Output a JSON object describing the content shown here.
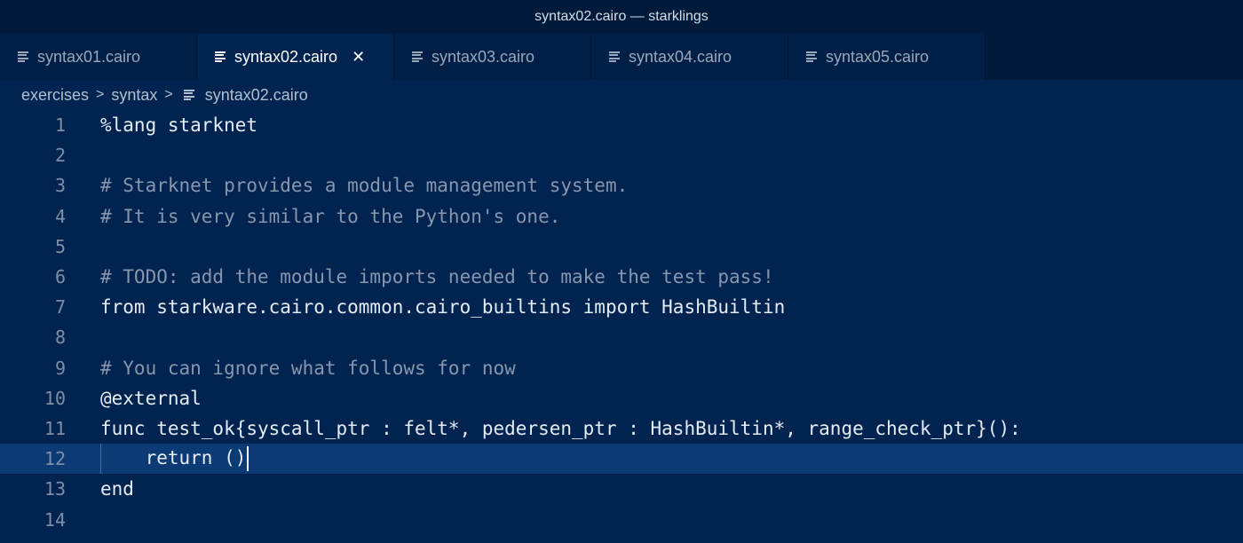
{
  "window": {
    "title": "syntax02.cairo — starklings"
  },
  "tabs": [
    {
      "label": "syntax01.cairo",
      "active": false
    },
    {
      "label": "syntax02.cairo",
      "active": true,
      "close": "✕"
    },
    {
      "label": "syntax03.cairo",
      "active": false
    },
    {
      "label": "syntax04.cairo",
      "active": false
    },
    {
      "label": "syntax05.cairo",
      "active": false
    }
  ],
  "breadcrumb": {
    "items": [
      "exercises",
      "syntax",
      "syntax02.cairo"
    ],
    "separator": ">"
  },
  "editor": {
    "current_line": 12,
    "lines": [
      {
        "num": "1",
        "text": "%lang starknet",
        "kind": "code"
      },
      {
        "num": "2",
        "text": "",
        "kind": "code"
      },
      {
        "num": "3",
        "text": "# Starknet provides a module management system.",
        "kind": "comment"
      },
      {
        "num": "4",
        "text": "# It is very similar to the Python's one.",
        "kind": "comment"
      },
      {
        "num": "5",
        "text": "",
        "kind": "code"
      },
      {
        "num": "6",
        "text": "# TODO: add the module imports needed to make the test pass!",
        "kind": "comment"
      },
      {
        "num": "7",
        "text": "from starkware.cairo.common.cairo_builtins import HashBuiltin",
        "kind": "code"
      },
      {
        "num": "8",
        "text": "",
        "kind": "code"
      },
      {
        "num": "9",
        "text": "# You can ignore what follows for now",
        "kind": "comment"
      },
      {
        "num": "10",
        "text": "@external",
        "kind": "code"
      },
      {
        "num": "11",
        "text": "func test_ok{syscall_ptr : felt*, pedersen_ptr : HashBuiltin*, range_check_ptr}():",
        "kind": "code"
      },
      {
        "num": "12",
        "text": "    return ()",
        "kind": "code"
      },
      {
        "num": "13",
        "text": "end",
        "kind": "code"
      },
      {
        "num": "14",
        "text": "",
        "kind": "code"
      }
    ]
  }
}
